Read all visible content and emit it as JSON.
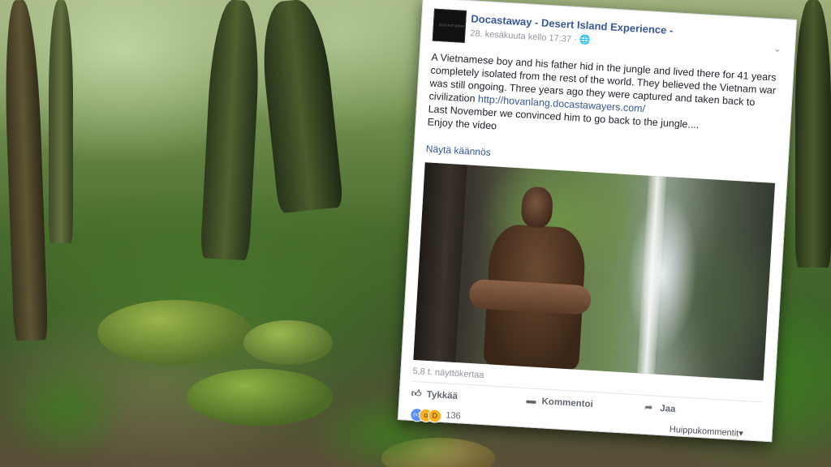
{
  "post": {
    "page_name": "Docastaway - Desert Island Experience -",
    "avatar_text": "DOCASTAWAY",
    "timestamp": "28. kesäkuuta kello 17:37 ·",
    "privacy_icon": "globe-icon",
    "options_icon": "chevron-down-icon",
    "body_part1": "A Vietnamese boy and his father hid in the jungle and lived there for 41 years completely isolated from the rest of the world. They believed the Vietnam war was still ongoing. Three years ago they were captured and taken back to civilization ",
    "body_link": "http://hovanlang.docastawayers.com/",
    "body_line2": "Last November we convinced him to go back to the jungle....",
    "body_line3": "Enjoy the video",
    "translate_label": "Näytä käännös",
    "views": "5,8 t. näyttökertaa"
  },
  "actions": {
    "like_label": "Tykkää",
    "comment_label": "Kommentoi",
    "share_label": "Jaa"
  },
  "reactions": {
    "count": "136",
    "types": [
      "like",
      "wow",
      "haha"
    ]
  },
  "comments": {
    "sort_label": "Huippukommentit▾"
  },
  "colors": {
    "link": "#365899",
    "like_reaction": "#5890ff",
    "emoji_reaction": "#f7b125"
  }
}
